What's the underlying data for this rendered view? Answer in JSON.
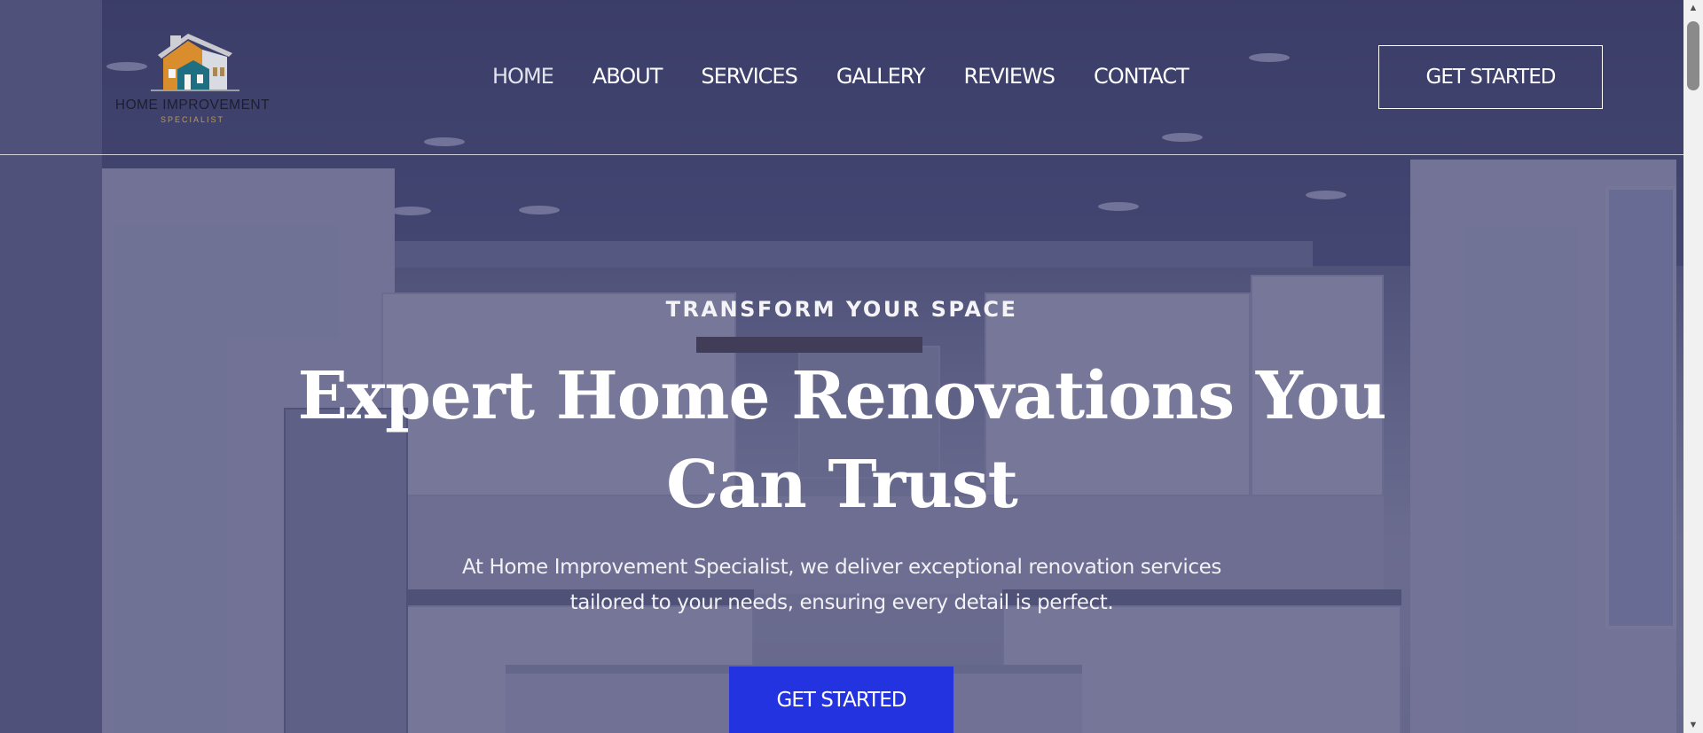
{
  "header": {
    "logo": {
      "name": "HOME IMPROVEMENT",
      "subtitle": "SPECIALIST",
      "icon": "house-icon"
    },
    "nav": [
      {
        "label": "HOME",
        "active": true
      },
      {
        "label": "ABOUT",
        "active": false
      },
      {
        "label": "SERVICES",
        "active": false
      },
      {
        "label": "GALLERY",
        "active": false
      },
      {
        "label": "REVIEWS",
        "active": false
      },
      {
        "label": "CONTACT",
        "active": false
      }
    ],
    "cta_label": "GET STARTED"
  },
  "hero": {
    "eyebrow": "TRANSFORM YOUR SPACE",
    "headline": "Expert Home Renovations You Can Trust",
    "lede": "At Home Improvement Specialist, we deliver exceptional renovation services tailored to your needs, ensuring every detail is perfect.",
    "cta_label": "GET STARTED"
  },
  "colors": {
    "overlay": "#2a2c5f",
    "primary_button": "#2433e0",
    "text": "#ffffff"
  },
  "scrollbar": {
    "up_icon": "arrow-up-icon",
    "down_icon": "arrow-down-icon"
  }
}
